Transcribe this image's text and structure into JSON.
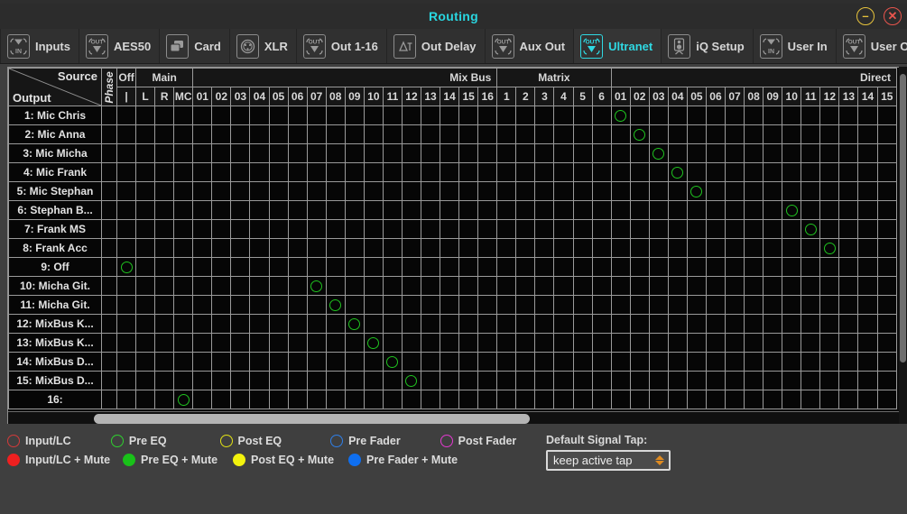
{
  "window": {
    "title": "Routing",
    "minimize_icon": "minimize-icon",
    "minimize_glyph": "–",
    "close_icon": "close-icon",
    "close_glyph": "✕",
    "bg_color": "#3f3f3f",
    "accent_color": "#29d6e0"
  },
  "tabs": [
    {
      "label": "Inputs",
      "icon": "input-arrow-icon",
      "dir": "IN",
      "active": false
    },
    {
      "label": "AES50",
      "icon": "output-arrow-icon",
      "dir": "OUT",
      "active": false
    },
    {
      "label": "Card",
      "icon": "card-icon",
      "dir": "",
      "active": false
    },
    {
      "label": "XLR",
      "icon": "xlr-connector-icon",
      "dir": "",
      "active": false
    },
    {
      "label": "Out 1-16",
      "icon": "output-arrow-icon",
      "dir": "OUT",
      "active": false
    },
    {
      "label": "Out Delay",
      "icon": "delta-t-icon",
      "dir": "",
      "active": false
    },
    {
      "label": "Aux Out",
      "icon": "output-arrow-icon",
      "dir": "OUT",
      "active": false
    },
    {
      "label": "Ultranet",
      "icon": "output-arrow-icon",
      "dir": "OUT",
      "active": true
    },
    {
      "label": "iQ Setup",
      "icon": "speaker-icon",
      "dir": "",
      "active": false
    },
    {
      "label": "User In",
      "icon": "input-arrow-icon",
      "dir": "IN",
      "active": false
    },
    {
      "label": "User Out",
      "icon": "output-arrow-icon",
      "dir": "OUT",
      "active": false
    }
  ],
  "matrix": {
    "corner": {
      "source_label": "Source",
      "output_label": "Output"
    },
    "phase_label": "Phase",
    "groups": [
      {
        "label": "Off",
        "span": 1
      },
      {
        "label": "Main",
        "span": 3
      },
      {
        "label": "Mix Bus",
        "span": 16
      },
      {
        "label": "Matrix",
        "span": 6
      },
      {
        "label": "Direct",
        "span": 15
      }
    ],
    "columns": [
      "|",
      "L",
      "R",
      "MC",
      "01",
      "02",
      "03",
      "04",
      "05",
      "06",
      "07",
      "08",
      "09",
      "10",
      "11",
      "12",
      "13",
      "14",
      "15",
      "16",
      "1",
      "2",
      "3",
      "4",
      "5",
      "6",
      "01",
      "02",
      "03",
      "04",
      "05",
      "06",
      "07",
      "08",
      "09",
      "10",
      "11",
      "12",
      "13",
      "14",
      "15"
    ],
    "rows": [
      {
        "label": "1: Mic Chris",
        "selected": 26
      },
      {
        "label": "2: Mic Anna",
        "selected": 27
      },
      {
        "label": "3: Mic Micha",
        "selected": 28
      },
      {
        "label": "4: Mic Frank",
        "selected": 29
      },
      {
        "label": "5: Mic Stephan",
        "selected": 30
      },
      {
        "label": "6: Stephan B...",
        "selected": 35
      },
      {
        "label": "7: Frank MS",
        "selected": 36
      },
      {
        "label": "8: Frank Acc",
        "selected": 37
      },
      {
        "label": "9: Off",
        "selected": 0
      },
      {
        "label": "10: Micha Git.",
        "selected": 10
      },
      {
        "label": "11: Micha Git.",
        "selected": 11
      },
      {
        "label": "12: MixBus K...",
        "selected": 12
      },
      {
        "label": "13: MixBus K...",
        "selected": 13
      },
      {
        "label": "14: MixBus D...",
        "selected": 14
      },
      {
        "label": "15: MixBus D...",
        "selected": 15
      },
      {
        "label": "16:",
        "selected": 3
      }
    ],
    "marker_color": "#1fc21f"
  },
  "legend": {
    "row1": [
      {
        "label": "Input/LC",
        "color": "#d43a3a",
        "filled": false
      },
      {
        "label": "Pre EQ",
        "color": "#2fd02f",
        "filled": false
      },
      {
        "label": "Post EQ",
        "color": "#e2e215",
        "filled": false
      },
      {
        "label": "Pre Fader",
        "color": "#2f7fe8",
        "filled": false
      },
      {
        "label": "Post Fader",
        "color": "#e33ad0",
        "filled": false
      }
    ],
    "row2": [
      {
        "label": "Input/LC + Mute",
        "color": "#ef2020",
        "filled": true
      },
      {
        "label": "Pre EQ + Mute",
        "color": "#19c119",
        "filled": true
      },
      {
        "label": "Post EQ + Mute",
        "color": "#f2f20d",
        "filled": true
      },
      {
        "label": "Pre Fader + Mute",
        "color": "#0f6ff0",
        "filled": true
      }
    ]
  },
  "default_signal_tap": {
    "label": "Default Signal Tap:",
    "value": "keep active tap",
    "options": [
      "keep active tap"
    ],
    "stepper_icon": "up-down-stepper-icon"
  },
  "scrollbars": {
    "horizontal_icon": "horizontal-scrollbar",
    "vertical_icon": "vertical-scrollbar"
  }
}
